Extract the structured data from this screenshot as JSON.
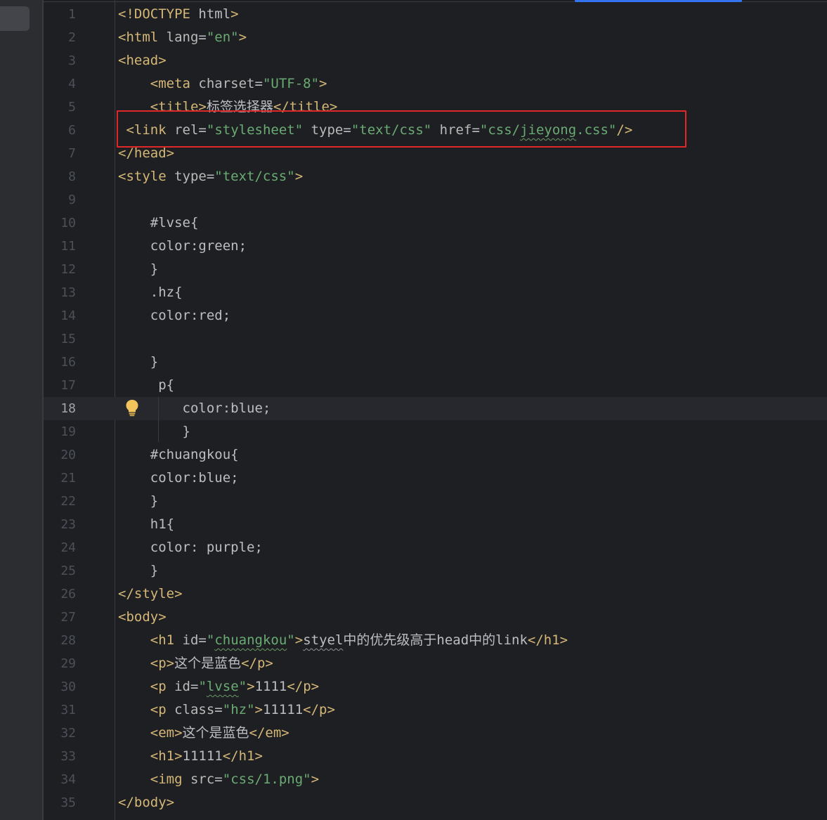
{
  "editor": {
    "current_line": 18,
    "lines": [
      {
        "no": "1",
        "segs": [
          {
            "c": "t",
            "v": "<!DOCTYPE "
          },
          {
            "c": "x",
            "v": "html"
          },
          {
            "c": "t",
            "v": ">"
          }
        ]
      },
      {
        "no": "2",
        "segs": [
          {
            "c": "t",
            "v": "<html "
          },
          {
            "c": "a",
            "v": "lang"
          },
          {
            "c": "x",
            "v": "="
          },
          {
            "c": "s",
            "v": "\"en\""
          },
          {
            "c": "t",
            "v": ">"
          }
        ]
      },
      {
        "no": "3",
        "segs": [
          {
            "c": "t",
            "v": "<head>"
          }
        ]
      },
      {
        "no": "4",
        "segs": [
          {
            "c": "x",
            "v": "    "
          },
          {
            "c": "t",
            "v": "<meta "
          },
          {
            "c": "a",
            "v": "charset"
          },
          {
            "c": "x",
            "v": "="
          },
          {
            "c": "s",
            "v": "\"UTF-8\""
          },
          {
            "c": "t",
            "v": ">"
          }
        ]
      },
      {
        "no": "5",
        "segs": [
          {
            "c": "x",
            "v": "    "
          },
          {
            "c": "t",
            "v": "<title>"
          },
          {
            "c": "x",
            "v": "标签选择器"
          },
          {
            "c": "t",
            "v": "</title>"
          }
        ]
      },
      {
        "no": "6",
        "segs": [
          {
            "c": "x",
            "v": " "
          },
          {
            "c": "t",
            "v": "<link "
          },
          {
            "c": "a",
            "v": "rel"
          },
          {
            "c": "x",
            "v": "="
          },
          {
            "c": "s",
            "v": "\"stylesheet\""
          },
          {
            "c": "x",
            "v": " "
          },
          {
            "c": "a",
            "v": "type"
          },
          {
            "c": "x",
            "v": "="
          },
          {
            "c": "s",
            "v": "\"text/css\""
          },
          {
            "c": "x",
            "v": " "
          },
          {
            "c": "a",
            "v": "href"
          },
          {
            "c": "x",
            "v": "="
          },
          {
            "c": "s",
            "v": "\"css/"
          },
          {
            "c": "s uw",
            "v": "jieyong"
          },
          {
            "c": "s",
            "v": ".css\""
          },
          {
            "c": "t",
            "v": "/>"
          }
        ]
      },
      {
        "no": "7",
        "segs": [
          {
            "c": "t",
            "v": "</head>"
          }
        ]
      },
      {
        "no": "8",
        "segs": [
          {
            "c": "t",
            "v": "<style "
          },
          {
            "c": "a",
            "v": "type"
          },
          {
            "c": "x",
            "v": "="
          },
          {
            "c": "s",
            "v": "\"text/css\""
          },
          {
            "c": "t",
            "v": ">"
          }
        ]
      },
      {
        "no": "9",
        "segs": []
      },
      {
        "no": "10",
        "segs": [
          {
            "c": "x",
            "v": "    #lvse{"
          }
        ]
      },
      {
        "no": "11",
        "segs": [
          {
            "c": "x",
            "v": "    color:green;"
          }
        ]
      },
      {
        "no": "12",
        "segs": [
          {
            "c": "x",
            "v": "    }"
          }
        ]
      },
      {
        "no": "13",
        "segs": [
          {
            "c": "x",
            "v": "    .hz{"
          }
        ]
      },
      {
        "no": "14",
        "segs": [
          {
            "c": "x",
            "v": "    color:red;"
          }
        ]
      },
      {
        "no": "15",
        "segs": []
      },
      {
        "no": "16",
        "segs": [
          {
            "c": "x",
            "v": "    }"
          }
        ]
      },
      {
        "no": "17",
        "segs": [
          {
            "c": "x",
            "v": "     p{"
          }
        ]
      },
      {
        "no": "18",
        "segs": [
          {
            "c": "x",
            "v": "        color:blue;"
          }
        ]
      },
      {
        "no": "19",
        "segs": [
          {
            "c": "x",
            "v": "        }"
          }
        ]
      },
      {
        "no": "20",
        "segs": [
          {
            "c": "x",
            "v": "    #chuangkou{"
          }
        ]
      },
      {
        "no": "21",
        "segs": [
          {
            "c": "x",
            "v": "    color:blue;"
          }
        ]
      },
      {
        "no": "22",
        "segs": [
          {
            "c": "x",
            "v": "    }"
          }
        ]
      },
      {
        "no": "23",
        "segs": [
          {
            "c": "x",
            "v": "    h1{"
          }
        ]
      },
      {
        "no": "24",
        "segs": [
          {
            "c": "x",
            "v": "    color: purple;"
          }
        ]
      },
      {
        "no": "25",
        "segs": [
          {
            "c": "x",
            "v": "    }"
          }
        ]
      },
      {
        "no": "26",
        "segs": [
          {
            "c": "t",
            "v": "</style>"
          }
        ]
      },
      {
        "no": "27",
        "segs": [
          {
            "c": "t",
            "v": "<body>"
          }
        ]
      },
      {
        "no": "28",
        "segs": [
          {
            "c": "x",
            "v": "    "
          },
          {
            "c": "t",
            "v": "<h1 "
          },
          {
            "c": "a",
            "v": "id"
          },
          {
            "c": "x",
            "v": "="
          },
          {
            "c": "s",
            "v": "\""
          },
          {
            "c": "s uw",
            "v": "chuangkou"
          },
          {
            "c": "s",
            "v": "\""
          },
          {
            "c": "t",
            "v": ">"
          },
          {
            "c": "x uwl",
            "v": "styel"
          },
          {
            "c": "x",
            "v": "中的优先级高于head中的link"
          },
          {
            "c": "t",
            "v": "</h1>"
          }
        ]
      },
      {
        "no": "29",
        "segs": [
          {
            "c": "x",
            "v": "    "
          },
          {
            "c": "t",
            "v": "<p>"
          },
          {
            "c": "x",
            "v": "这个是蓝色"
          },
          {
            "c": "t",
            "v": "</p>"
          }
        ]
      },
      {
        "no": "30",
        "segs": [
          {
            "c": "x",
            "v": "    "
          },
          {
            "c": "t",
            "v": "<p "
          },
          {
            "c": "a",
            "v": "id"
          },
          {
            "c": "x",
            "v": "="
          },
          {
            "c": "s",
            "v": "\""
          },
          {
            "c": "s uw",
            "v": "lvse"
          },
          {
            "c": "s",
            "v": "\""
          },
          {
            "c": "t",
            "v": ">"
          },
          {
            "c": "x",
            "v": "1111"
          },
          {
            "c": "t",
            "v": "</p>"
          }
        ]
      },
      {
        "no": "31",
        "segs": [
          {
            "c": "x",
            "v": "    "
          },
          {
            "c": "t",
            "v": "<p "
          },
          {
            "c": "a",
            "v": "class"
          },
          {
            "c": "x",
            "v": "="
          },
          {
            "c": "s",
            "v": "\"hz\""
          },
          {
            "c": "t",
            "v": ">"
          },
          {
            "c": "x",
            "v": "11111"
          },
          {
            "c": "t",
            "v": "</p>"
          }
        ]
      },
      {
        "no": "32",
        "segs": [
          {
            "c": "x",
            "v": "    "
          },
          {
            "c": "t",
            "v": "<em>"
          },
          {
            "c": "x",
            "v": "这个是蓝色"
          },
          {
            "c": "t",
            "v": "</em>"
          }
        ]
      },
      {
        "no": "33",
        "segs": [
          {
            "c": "x",
            "v": "    "
          },
          {
            "c": "t",
            "v": "<h1>"
          },
          {
            "c": "x",
            "v": "11111"
          },
          {
            "c": "t",
            "v": "</h1>"
          }
        ]
      },
      {
        "no": "34",
        "segs": [
          {
            "c": "x",
            "v": "    "
          },
          {
            "c": "t",
            "v": "<img "
          },
          {
            "c": "a",
            "v": "src"
          },
          {
            "c": "x",
            "v": "="
          },
          {
            "c": "s",
            "v": "\"css/1.png\""
          },
          {
            "c": "t",
            "v": ">"
          }
        ]
      },
      {
        "no": "35",
        "segs": [
          {
            "c": "t",
            "v": "</body>"
          }
        ]
      }
    ]
  },
  "icons": {
    "intention": "lightbulb-icon"
  },
  "colors": {
    "tag": "#d5b778",
    "attribute": "#bababa",
    "string": "#6aab73",
    "text": "#bcbec4",
    "highlight_box": "#e02828",
    "tab_indicator": "#3574f0"
  }
}
